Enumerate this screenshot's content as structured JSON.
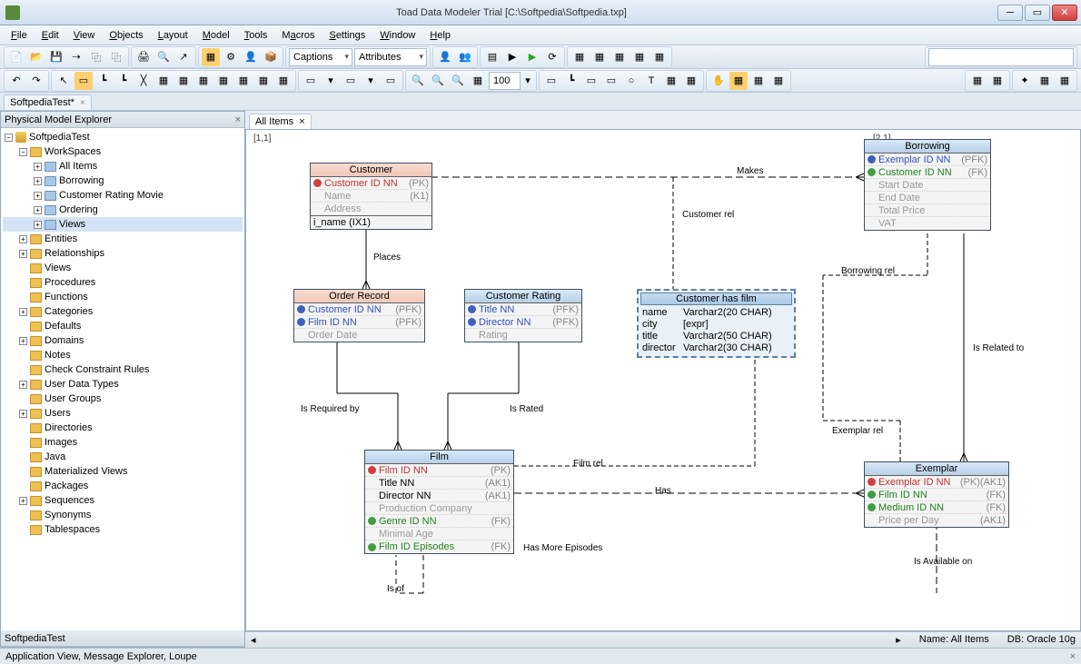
{
  "titlebar": {
    "title": "Toad Data Modeler Trial [C:\\Softpedia\\Softpedia.txp]"
  },
  "menubar": [
    "File",
    "Edit",
    "View",
    "Objects",
    "Layout",
    "Model",
    "Tools",
    "Macros",
    "Settings",
    "Window",
    "Help"
  ],
  "toolbar1": {
    "combo1": "Captions",
    "combo2": "Attributes"
  },
  "toolbar2": {
    "zoom": "100"
  },
  "doc_tab": {
    "label": "SoftpediaTest*"
  },
  "sidebar": {
    "title": "Physical Model Explorer",
    "footer": "SoftpediaTest",
    "tree": {
      "root": "SoftpediaTest",
      "workspaces": {
        "label": "WorkSpaces",
        "items": [
          "All Items",
          "Borrowing",
          "Customer Rating Movie",
          "Ordering",
          "Views"
        ]
      },
      "folders": [
        "Entities",
        "Relationships",
        "Views",
        "Procedures",
        "Functions",
        "Categories",
        "Defaults",
        "Domains",
        "Notes",
        "Check Constraint Rules",
        "User Data Types",
        "User Groups",
        "Users",
        "Directories",
        "Images",
        "Java",
        "Materialized Views",
        "Packages",
        "Sequences",
        "Synonyms",
        "Tablespaces"
      ]
    }
  },
  "main_tab": {
    "label": "All Items"
  },
  "canvas": {
    "coord1": "[1,1]",
    "coord2": "[2,1]"
  },
  "entities": {
    "customer": {
      "title": "Customer",
      "rows": [
        {
          "icon": "red",
          "name": "Customer ID NN",
          "suffix": "(PK)",
          "cls": "red"
        },
        {
          "icon": "",
          "name": "Name",
          "suffix": "(K1)",
          "cls": "grey"
        },
        {
          "icon": "",
          "name": "Address",
          "suffix": "",
          "cls": "grey"
        }
      ],
      "index": "i_name (IX1)"
    },
    "borrowing": {
      "title": "Borrowing",
      "rows": [
        {
          "icon": "blue",
          "name": "Exemplar ID NN",
          "suffix": "(PFK)",
          "cls": "blue"
        },
        {
          "icon": "green",
          "name": "Customer ID NN",
          "suffix": "(FK)",
          "cls": "green"
        },
        {
          "icon": "",
          "name": "Start Date",
          "suffix": "",
          "cls": "grey"
        },
        {
          "icon": "",
          "name": "End Date",
          "suffix": "",
          "cls": "grey"
        },
        {
          "icon": "",
          "name": "Total Price",
          "suffix": "",
          "cls": "grey"
        },
        {
          "icon": "",
          "name": "VAT",
          "suffix": "",
          "cls": "grey"
        }
      ]
    },
    "order_record": {
      "title": "Order Record",
      "rows": [
        {
          "icon": "blue",
          "name": "Customer ID NN",
          "suffix": "(PFK)",
          "cls": "blue"
        },
        {
          "icon": "blue",
          "name": "Film ID NN",
          "suffix": "(PFK)",
          "cls": "blue"
        },
        {
          "icon": "",
          "name": "Order Date",
          "suffix": "",
          "cls": "grey"
        }
      ]
    },
    "customer_rating": {
      "title": "Customer Rating",
      "rows": [
        {
          "icon": "blue",
          "name": "Title NN",
          "suffix": "(PFK)",
          "cls": "blue"
        },
        {
          "icon": "blue",
          "name": "Director NN",
          "suffix": "(PFK)",
          "cls": "blue"
        },
        {
          "icon": "",
          "name": "Rating",
          "suffix": "",
          "cls": "grey"
        }
      ]
    },
    "film": {
      "title": "Film",
      "rows": [
        {
          "icon": "red",
          "name": "Film ID NN",
          "suffix": "(PK)",
          "cls": "red"
        },
        {
          "icon": "",
          "name": "Title NN",
          "suffix": "(AK1)",
          "cls": "black"
        },
        {
          "icon": "",
          "name": "Director NN",
          "suffix": "(AK1)",
          "cls": "black"
        },
        {
          "icon": "",
          "name": "Production Company",
          "suffix": "",
          "cls": "grey"
        },
        {
          "icon": "green",
          "name": "Genre ID NN",
          "suffix": "(FK)",
          "cls": "green"
        },
        {
          "icon": "",
          "name": "Minimal Age",
          "suffix": "",
          "cls": "grey"
        },
        {
          "icon": "green",
          "name": "Film ID Episodes",
          "suffix": "(FK)",
          "cls": "green"
        }
      ]
    },
    "exemplar": {
      "title": "Exemplar",
      "rows": [
        {
          "icon": "red",
          "name": "Exemplar ID NN",
          "suffix": "(PK)(AK1)",
          "cls": "red"
        },
        {
          "icon": "green",
          "name": "Film ID NN",
          "suffix": "(FK)",
          "cls": "green"
        },
        {
          "icon": "green",
          "name": "Medium ID NN",
          "suffix": "(FK)",
          "cls": "green"
        },
        {
          "icon": "",
          "name": "Price per Day",
          "suffix": "(AK1)",
          "cls": "grey"
        }
      ]
    },
    "customer_has_film": {
      "title": "Customer has film",
      "rows": [
        {
          "c1": "name",
          "c2": "Varchar2(20 CHAR)"
        },
        {
          "c1": "city",
          "c2": "[expr]"
        },
        {
          "c1": "title",
          "c2": "Varchar2(50 CHAR)"
        },
        {
          "c1": "director",
          "c2": "Varchar2(30 CHAR)"
        }
      ]
    }
  },
  "relationships": {
    "makes": "Makes",
    "customer_rel": "Customer rel",
    "places": "Places",
    "borrowing_rel": "Borrowing rel",
    "is_related_to": "Is Related to",
    "is_required_by": "Is Required by",
    "is_rated": "Is Rated",
    "film_rel": "Film rel",
    "exemplar_rel": "Exemplar rel",
    "has": "Has",
    "has_more_episodes": "Has More Episodes",
    "is_of": "Is of",
    "is_available_on": "Is Available on"
  },
  "statusbar": {
    "name_label": "Name: All Items",
    "db_label": "DB: Oracle 10g"
  },
  "footer": {
    "text": "Application View, Message Explorer, Loupe"
  }
}
